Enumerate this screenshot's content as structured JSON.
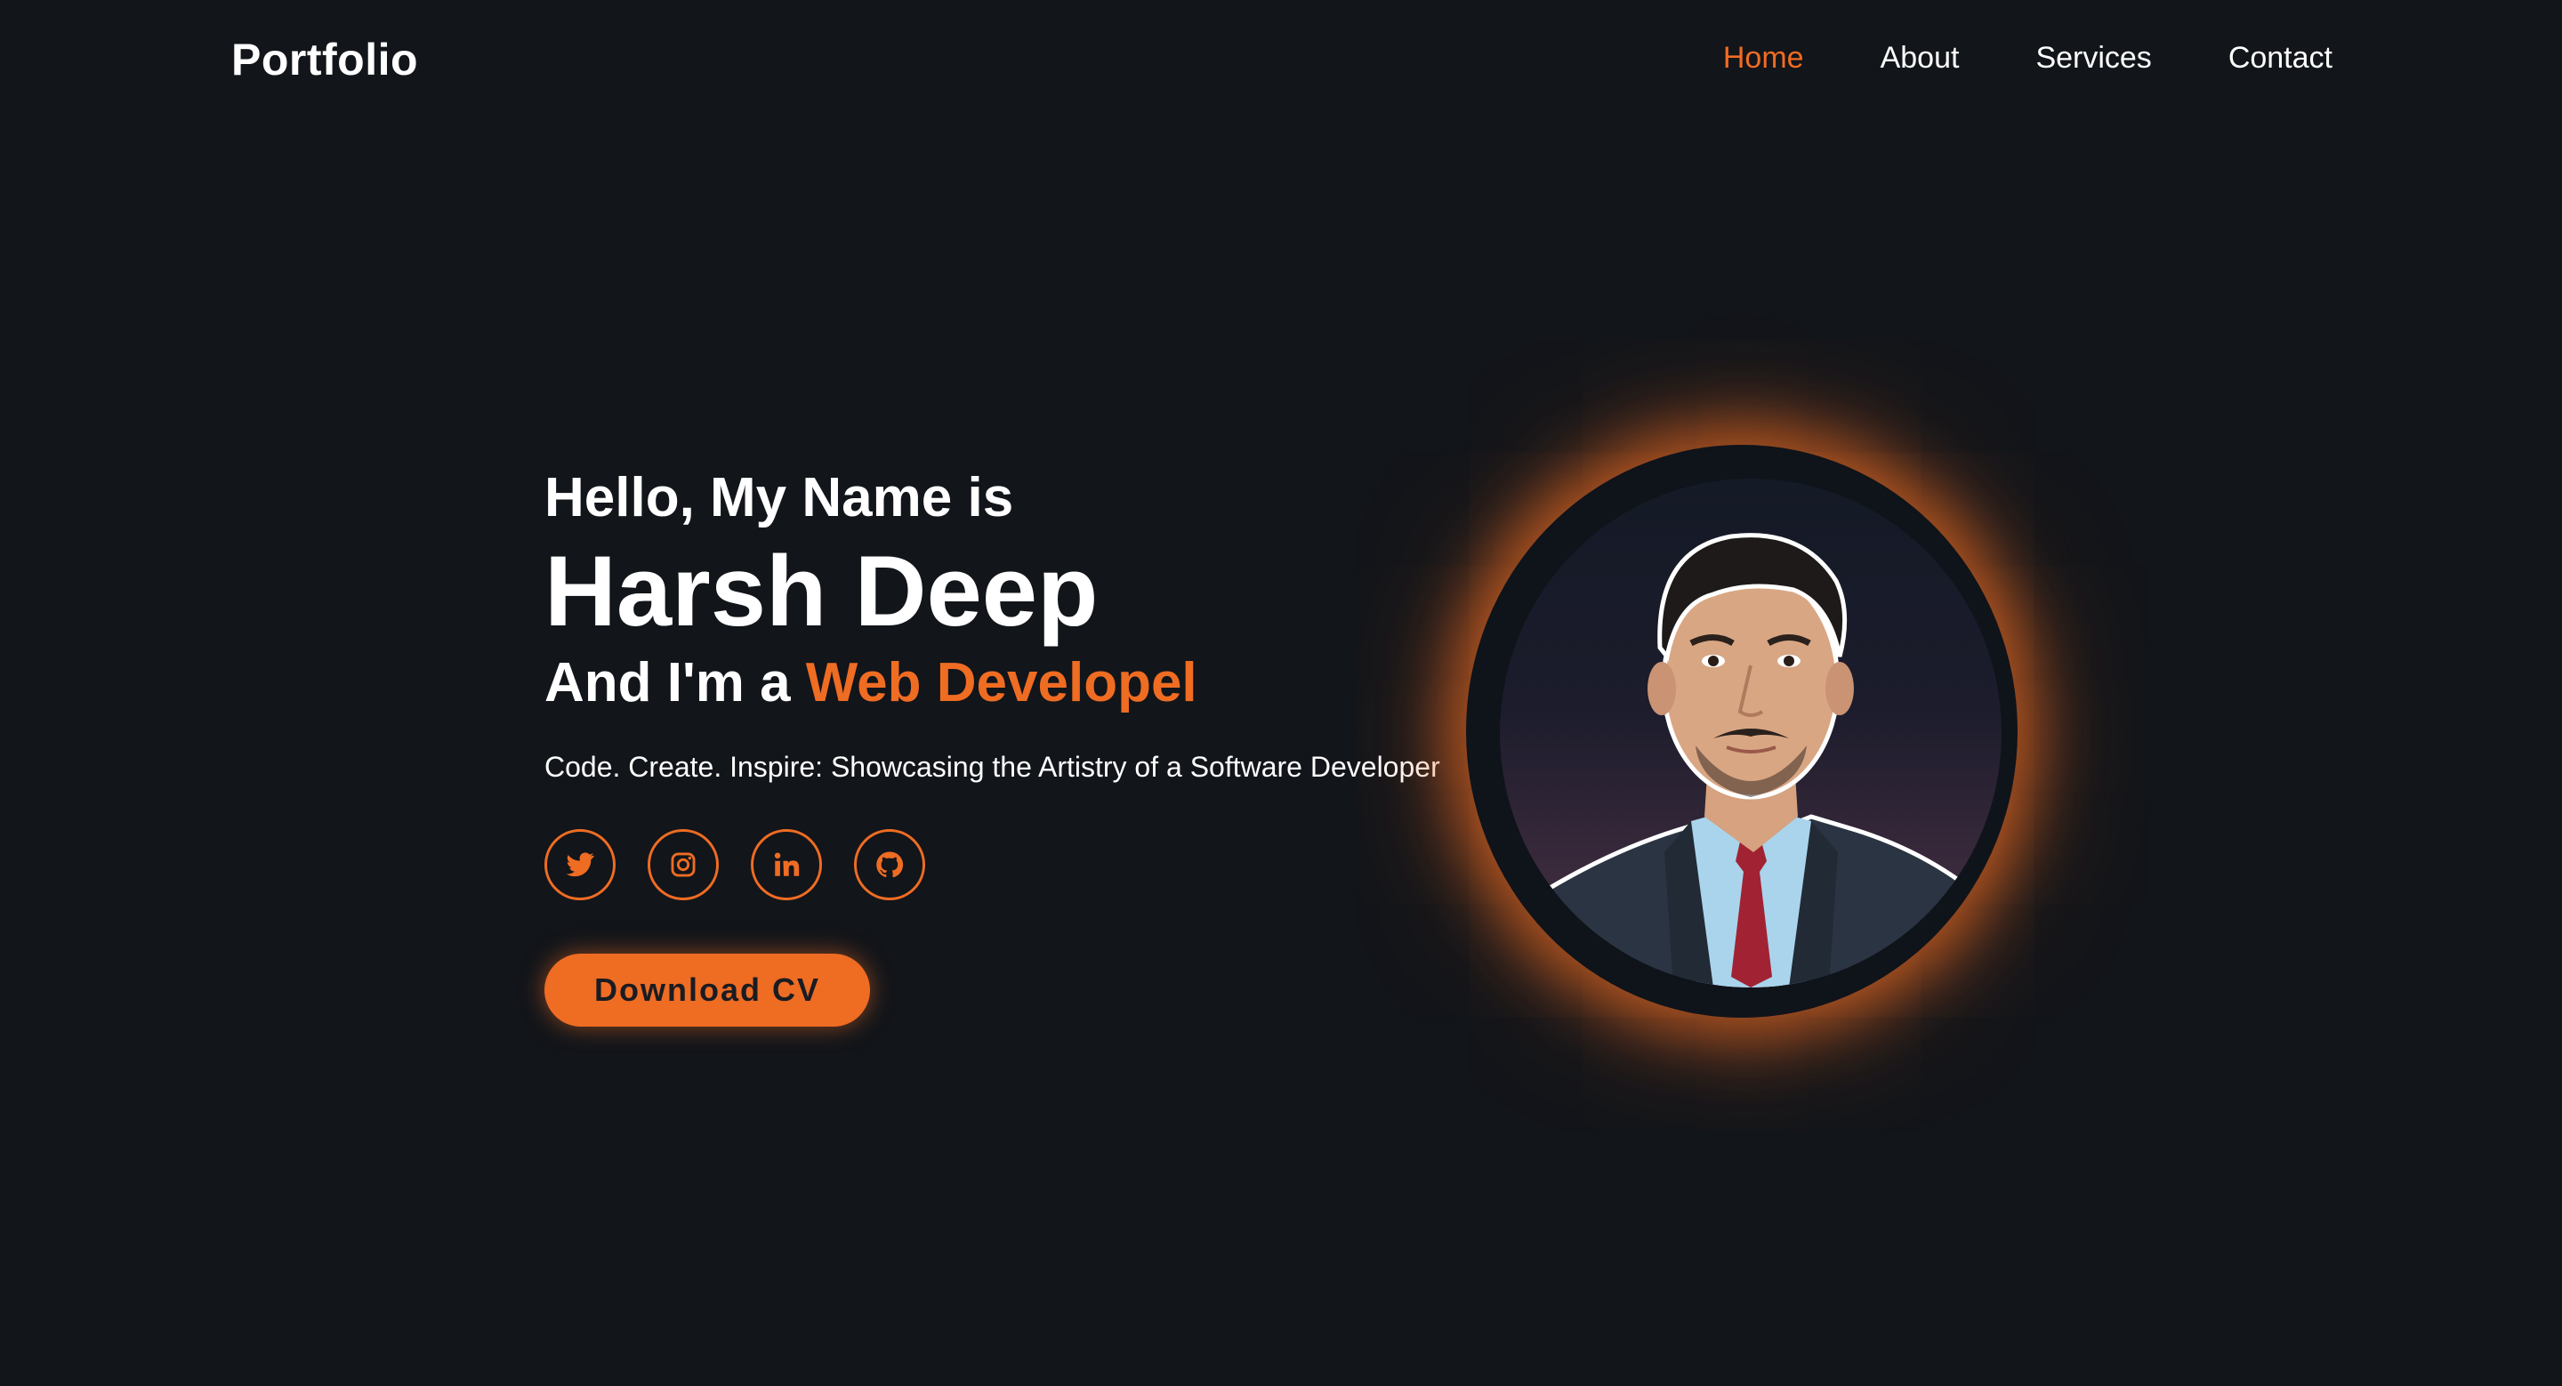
{
  "header": {
    "logo": "Portfolio",
    "nav": [
      {
        "label": "Home",
        "active": true
      },
      {
        "label": "About",
        "active": false
      },
      {
        "label": "Services",
        "active": false
      },
      {
        "label": "Contact",
        "active": false
      }
    ]
  },
  "hero": {
    "greeting": "Hello, My Name is",
    "name": "Harsh Deep",
    "role_prefix": "And I'm a ",
    "role_highlight": "Web Developel",
    "tagline": "Code. Create. Inspire: Showcasing the Artistry of a Software Developer",
    "socials": [
      {
        "icon": "twitter-icon"
      },
      {
        "icon": "instagram-icon"
      },
      {
        "icon": "linkedin-icon"
      },
      {
        "icon": "github-icon"
      }
    ],
    "cta_label": "Download CV"
  },
  "profile": {
    "icon": "profile-photo"
  },
  "colors": {
    "background": "#12151a",
    "accent": "#ef6c23",
    "text": "#ffffff"
  }
}
